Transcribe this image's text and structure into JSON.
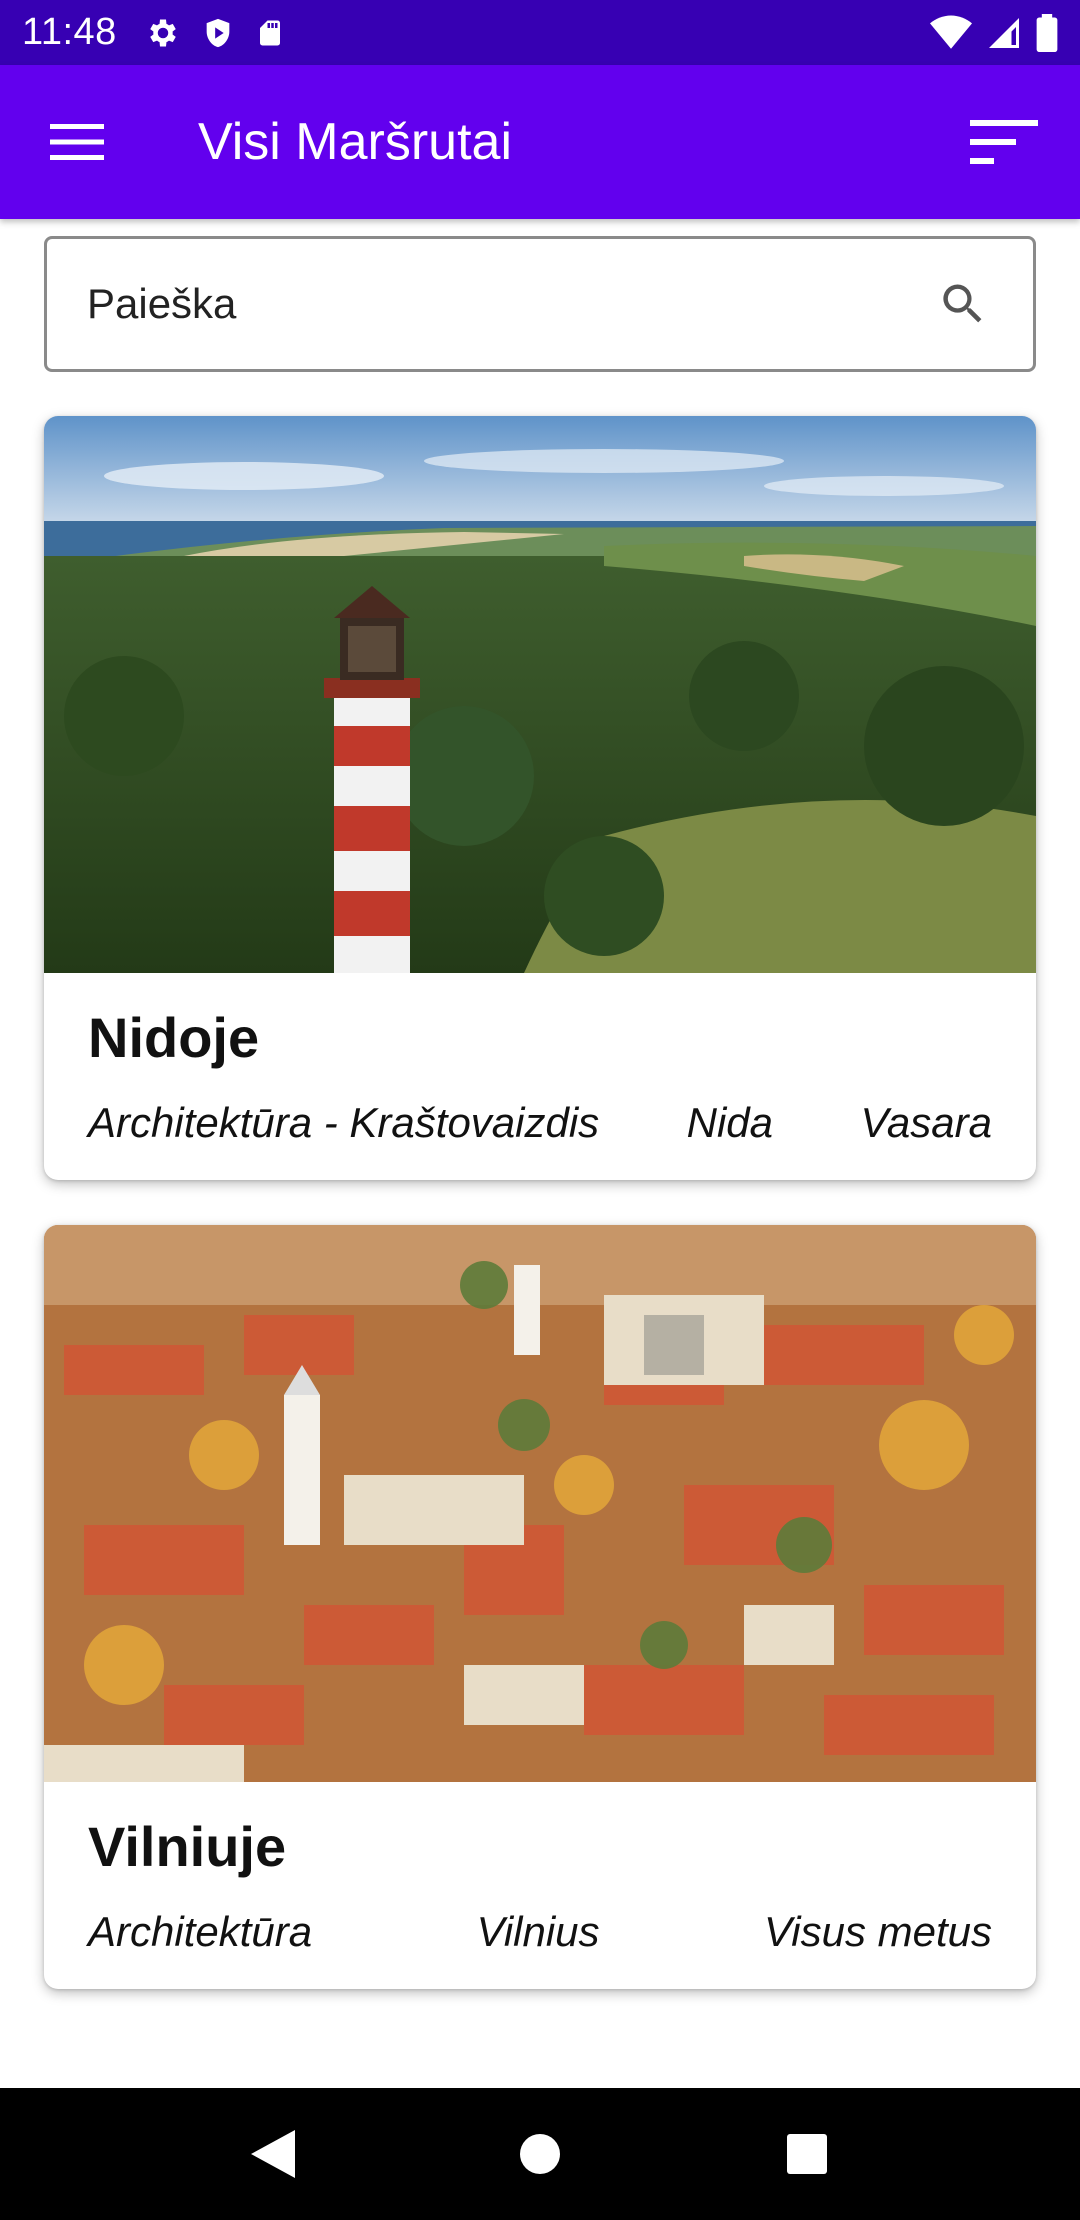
{
  "status_bar": {
    "time": "11:48",
    "left_icons": [
      "gear-icon",
      "shield-icon",
      "sd-card-icon"
    ],
    "right_icons": [
      "wifi-icon",
      "cell-signal-icon",
      "battery-icon"
    ]
  },
  "app_bar": {
    "title": "Visi Maršrutai",
    "menu_icon": "hamburger-menu-icon",
    "filter_icon": "sort-filter-icon",
    "background": "#6200ee",
    "status_background": "#3700b3"
  },
  "search": {
    "placeholder": "Paieška",
    "icon": "search-icon"
  },
  "routes": [
    {
      "title": "Nidoje",
      "category": "Architektūra - Kraštovaizdis",
      "city": "Nida",
      "season": "Vasara",
      "image": "lighthouse-forest-coast-photo"
    },
    {
      "title": "Vilniuje",
      "category": "Architektūra",
      "city": "Vilnius",
      "season": "Visus metus",
      "image": "vilnius-old-town-aerial-photo"
    }
  ],
  "nav_bar": {
    "icons": [
      "back-triangle-icon",
      "home-circle-icon",
      "recents-square-icon"
    ]
  }
}
